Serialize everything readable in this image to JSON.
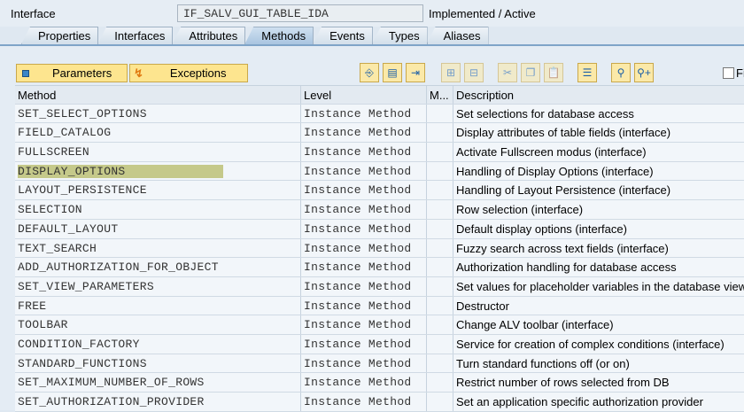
{
  "header": {
    "label": "Interface",
    "name": "IF_SALV_GUI_TABLE_IDA",
    "status": "Implemented / Active"
  },
  "tabs": [
    {
      "label": "Properties"
    },
    {
      "label": "Interfaces"
    },
    {
      "label": "Attributes"
    },
    {
      "label": "Methods",
      "active": true
    },
    {
      "label": "Events"
    },
    {
      "label": "Types"
    },
    {
      "label": "Aliases"
    }
  ],
  "toolbar": {
    "parameters": "Parameters",
    "exceptions": "Exceptions",
    "filter_label": "Fi",
    "icons": [
      "source-code-icon",
      "detail-icon",
      "navigate-icon",
      "insert-row-icon",
      "delete-row-icon",
      "cut-icon",
      "copy-icon",
      "paste-icon",
      "sort-icon",
      "find-icon",
      "find-next-icon"
    ]
  },
  "table": {
    "columns": [
      "Method",
      "Level",
      "M...",
      "Description"
    ],
    "rows": [
      [
        "SET_SELECT_OPTIONS",
        "Instance Method",
        "",
        "Set selections for database access"
      ],
      [
        "FIELD_CATALOG",
        "Instance Method",
        "",
        "Display attributes of table fields (interface)"
      ],
      [
        "FULLSCREEN",
        "Instance Method",
        "",
        "Activate Fullscreen modus (interface)"
      ],
      [
        "DISPLAY_OPTIONS",
        "Instance Method",
        "",
        "Handling of Display Options (interface)"
      ],
      [
        "LAYOUT_PERSISTENCE",
        "Instance Method",
        "",
        "Handling of Layout Persistence (interface)"
      ],
      [
        "SELECTION",
        "Instance Method",
        "",
        "Row selection (interface)"
      ],
      [
        "DEFAULT_LAYOUT",
        "Instance Method",
        "",
        "Default display options (interface)"
      ],
      [
        "TEXT_SEARCH",
        "Instance Method",
        "",
        "Fuzzy search across text fields (interface)"
      ],
      [
        "ADD_AUTHORIZATION_FOR_OBJECT",
        "Instance Method",
        "",
        "Authorization handling for database access"
      ],
      [
        "SET_VIEW_PARAMETERS",
        "Instance Method",
        "",
        "Set values for placeholder variables in the database view"
      ],
      [
        "FREE",
        "Instance Method",
        "",
        "Destructor"
      ],
      [
        "TOOLBAR",
        "Instance Method",
        "",
        "Change ALV toolbar (interface)"
      ],
      [
        "CONDITION_FACTORY",
        "Instance Method",
        "",
        "Service for creation of complex conditions (interface)"
      ],
      [
        "STANDARD_FUNCTIONS",
        "Instance Method",
        "",
        "Turn standard functions off (or on)"
      ],
      [
        "SET_MAXIMUM_NUMBER_OF_ROWS",
        "Instance Method",
        "",
        "Restrict number of rows selected from DB"
      ],
      [
        "SET_AUTHORIZATION_PROVIDER",
        "Instance Method",
        "",
        "Set an application specific authorization provider"
      ]
    ],
    "selected_row": 3
  }
}
